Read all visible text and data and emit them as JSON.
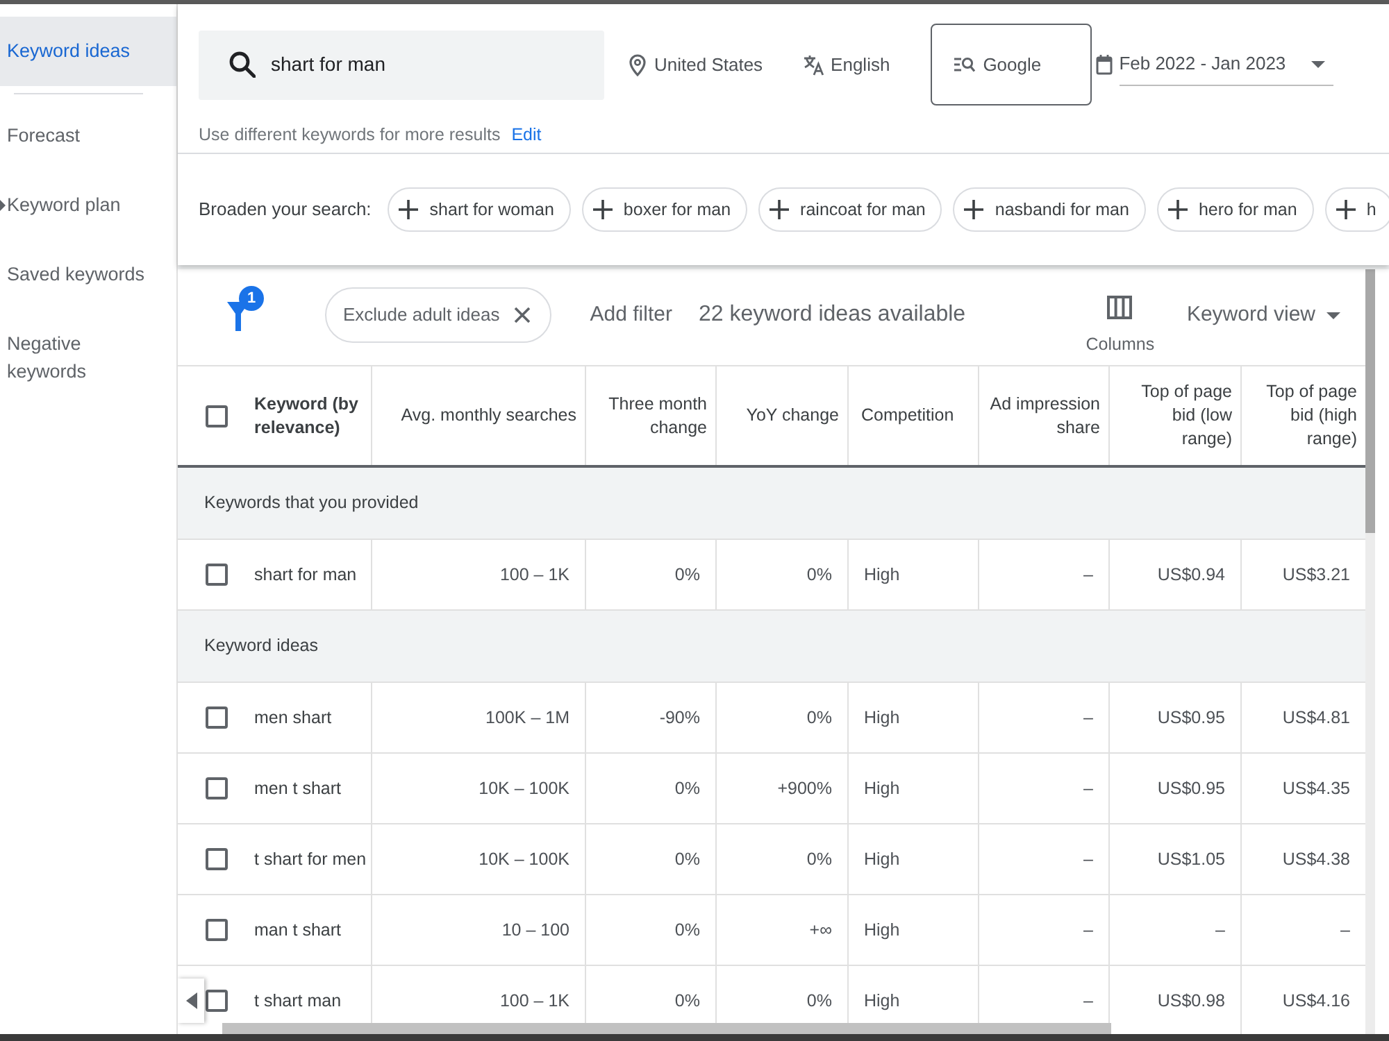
{
  "sidebar": {
    "items": [
      {
        "label": "Keyword ideas",
        "selected": true,
        "expandable": false
      },
      {
        "label": "Forecast",
        "selected": false,
        "expandable": false
      },
      {
        "label": "Keyword plan",
        "selected": false,
        "expandable": true
      },
      {
        "label": "Saved keywords",
        "selected": false,
        "expandable": false
      },
      {
        "label": "Negative keywords",
        "selected": false,
        "expandable": false
      }
    ]
  },
  "search": {
    "value": "shart for man"
  },
  "targeting": [
    {
      "kind": "location",
      "label": "United States"
    },
    {
      "kind": "language",
      "label": "English"
    },
    {
      "kind": "network",
      "label": "Google"
    },
    {
      "kind": "date_range",
      "label": "Feb 2022 - Jan 2023"
    }
  ],
  "hint": {
    "text": "Use different keywords for more results",
    "link": "Edit"
  },
  "broaden": {
    "label": "Broaden your search:",
    "chips": [
      "shart for woman",
      "boxer for man",
      "raincoat for man",
      "nasbandi for man",
      "hero for man",
      "h"
    ]
  },
  "toolbar": {
    "filter_count": "1",
    "filters": [
      "Exclude adult ideas"
    ],
    "add_filter": "Add filter",
    "summary": "22 keyword ideas available",
    "columns_button": "Columns",
    "view_menu": "Keyword view"
  },
  "table": {
    "select_all": {
      "checked": false
    },
    "columns": [
      "Keyword (by relevance)",
      "Avg. monthly searches",
      "Three month change",
      "YoY change",
      "Competition",
      "Ad impression share",
      "Top of page bid (low range)",
      "Top of page bid (high range)"
    ],
    "groups": [
      {
        "title": "Keywords that you provided",
        "rows": [
          {
            "checked": false,
            "cells": [
              "shart for man",
              "100 – 1K",
              "0%",
              "0%",
              "High",
              "–",
              "US$0.94",
              "US$3.21"
            ]
          }
        ]
      },
      {
        "title": "Keyword ideas",
        "rows": [
          {
            "checked": false,
            "cells": [
              "men shart",
              "100K – 1M",
              "-90%",
              "0%",
              "High",
              "–",
              "US$0.95",
              "US$4.81"
            ]
          },
          {
            "checked": false,
            "cells": [
              "men t shart",
              "10K – 100K",
              "0%",
              "+900%",
              "High",
              "–",
              "US$0.95",
              "US$4.35"
            ]
          },
          {
            "checked": false,
            "cells": [
              "t shart for men",
              "10K – 100K",
              "0%",
              "0%",
              "High",
              "–",
              "US$1.05",
              "US$4.38"
            ]
          },
          {
            "checked": false,
            "cells": [
              "man t shart",
              "10 – 100",
              "0%",
              "+∞",
              "High",
              "–",
              "–",
              "–"
            ]
          },
          {
            "checked": false,
            "cells": [
              "t shart man",
              "100 – 1K",
              "0%",
              "0%",
              "High",
              "–",
              "US$0.98",
              "US$4.16"
            ]
          }
        ]
      }
    ]
  }
}
